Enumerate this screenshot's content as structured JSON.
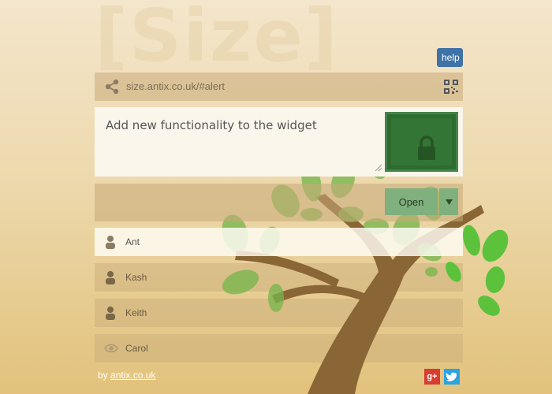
{
  "background": {
    "logo_text": "[Size]"
  },
  "header": {
    "help_label": "help"
  },
  "url_bar": {
    "url": "size.antix.co.uk/#alert",
    "share_icon": "share-icon",
    "qr_icon": "qr-code-icon"
  },
  "note": {
    "text": "Add new functionality to the widget",
    "lock_icon": "lock-icon"
  },
  "actions": {
    "open_label": "Open",
    "dropdown_icon": "chevron-down-icon"
  },
  "users": [
    {
      "name": "Ant",
      "icon": "person-icon",
      "active": true
    },
    {
      "name": "Kash",
      "icon": "person-icon",
      "active": false
    },
    {
      "name": "Keith",
      "icon": "person-icon",
      "active": false
    },
    {
      "name": "Carol",
      "icon": "eye-icon",
      "active": false
    }
  ],
  "footer": {
    "prefix": "by",
    "link_text": "antix.co.uk",
    "gplus_label": "g+",
    "social_icons": [
      "google-plus-icon",
      "twitter-icon"
    ]
  },
  "colors": {
    "help_button": "#3f73a8",
    "lock_tile": "#2e6b2e",
    "open_button": "#7fb07d",
    "gplus": "#d53e31",
    "twitter": "#2aa3e0"
  }
}
